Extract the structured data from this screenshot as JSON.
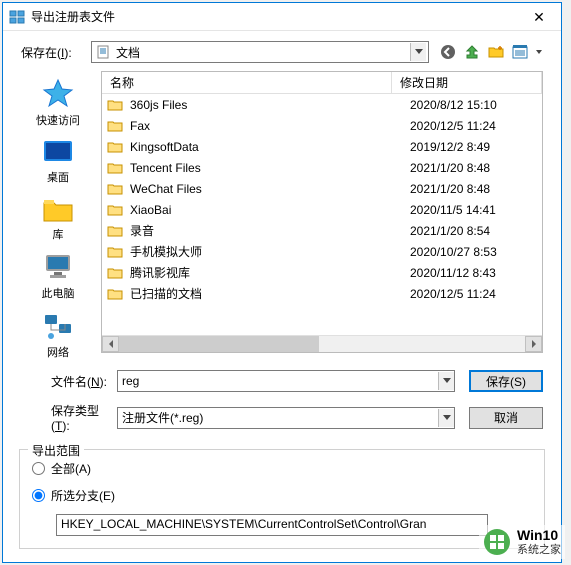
{
  "title": "导出注册表文件",
  "savein": {
    "label_pre": "保存在(",
    "label_hot": "I",
    "label_post": "):",
    "value": "文档"
  },
  "columns": {
    "name": "名称",
    "date": "修改日期"
  },
  "sidebar": {
    "items": [
      {
        "label": "快速访问"
      },
      {
        "label": "桌面"
      },
      {
        "label": "库"
      },
      {
        "label": "此电脑"
      },
      {
        "label": "网络"
      }
    ]
  },
  "files": [
    {
      "name": "360js Files",
      "date": "2020/8/12 15:10"
    },
    {
      "name": "Fax",
      "date": "2020/12/5 11:24"
    },
    {
      "name": "KingsoftData",
      "date": "2019/12/2 8:49"
    },
    {
      "name": "Tencent Files",
      "date": "2021/1/20 8:48"
    },
    {
      "name": "WeChat Files",
      "date": "2021/1/20 8:48"
    },
    {
      "name": "XiaoBai",
      "date": "2020/11/5 14:41"
    },
    {
      "name": "录音",
      "date": "2021/1/20 8:54"
    },
    {
      "name": "手机模拟大师",
      "date": "2020/10/27 8:53"
    },
    {
      "name": "腾讯影视库",
      "date": "2020/11/12 8:43"
    },
    {
      "name": "已扫描的文档",
      "date": "2020/12/5 11:24"
    }
  ],
  "filename": {
    "label_pre": "文件名(",
    "label_hot": "N",
    "label_post": "):",
    "value": "reg"
  },
  "filetype": {
    "label_pre": "保存类型(",
    "label_hot": "T",
    "label_post": "):",
    "value": "注册文件(*.reg)"
  },
  "buttons": {
    "save": "保存(S)",
    "cancel": "取消"
  },
  "scope": {
    "legend": "导出范围",
    "all_pre": "全部(",
    "all_hot": "A",
    "all_post": ")",
    "sel_pre": "所选分支(",
    "sel_hot": "E",
    "sel_post": ")",
    "path": "HKEY_LOCAL_MACHINE\\SYSTEM\\CurrentControlSet\\Control\\Gran"
  },
  "watermark": {
    "line1": "Win10",
    "line2": "系统之家"
  }
}
